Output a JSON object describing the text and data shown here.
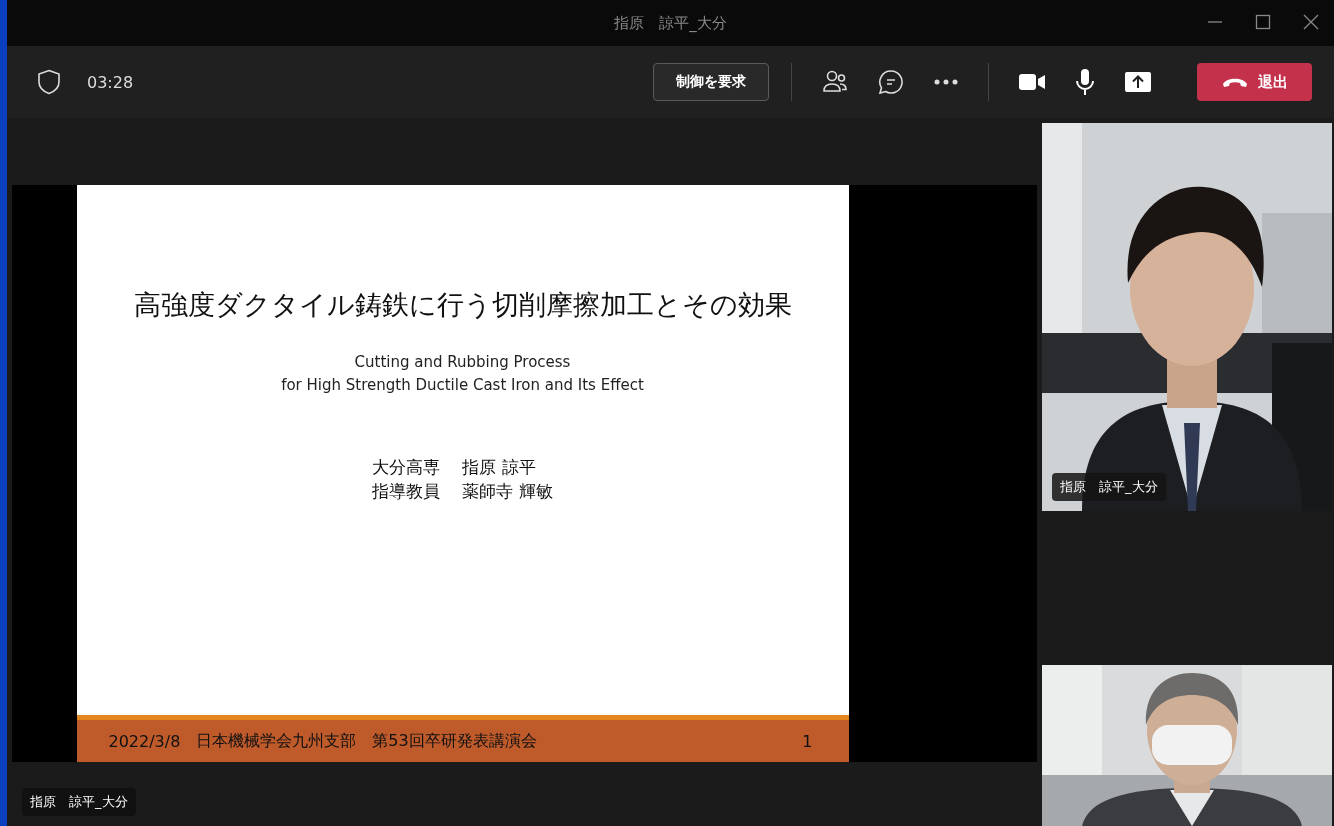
{
  "window": {
    "title": "指原　諒平_大分"
  },
  "toolbar": {
    "timer": "03:28",
    "request_control": "制御を要求",
    "leave": "退出"
  },
  "shared_screen": {
    "slide": {
      "title": "高強度ダクタイル鋳鉄に行う切削摩擦加工とその効果",
      "subtitle": [
        "Cutting and Rubbing Process",
        "for High Strength Ductile Cast Iron and Its Effect"
      ],
      "authors": [
        {
          "affiliation": "大分高専",
          "name": "指原 諒平"
        },
        {
          "affiliation": "指導教員",
          "name": "薬師寺 輝敏"
        }
      ],
      "footer": {
        "date": "2022/3/8",
        "event": "日本機械学会九州支部　第53回卒研発表講演会",
        "page": "1"
      }
    },
    "presenter": "指原　諒平_大分"
  },
  "participant_video": {
    "name": "指原　諒平_大分"
  }
}
